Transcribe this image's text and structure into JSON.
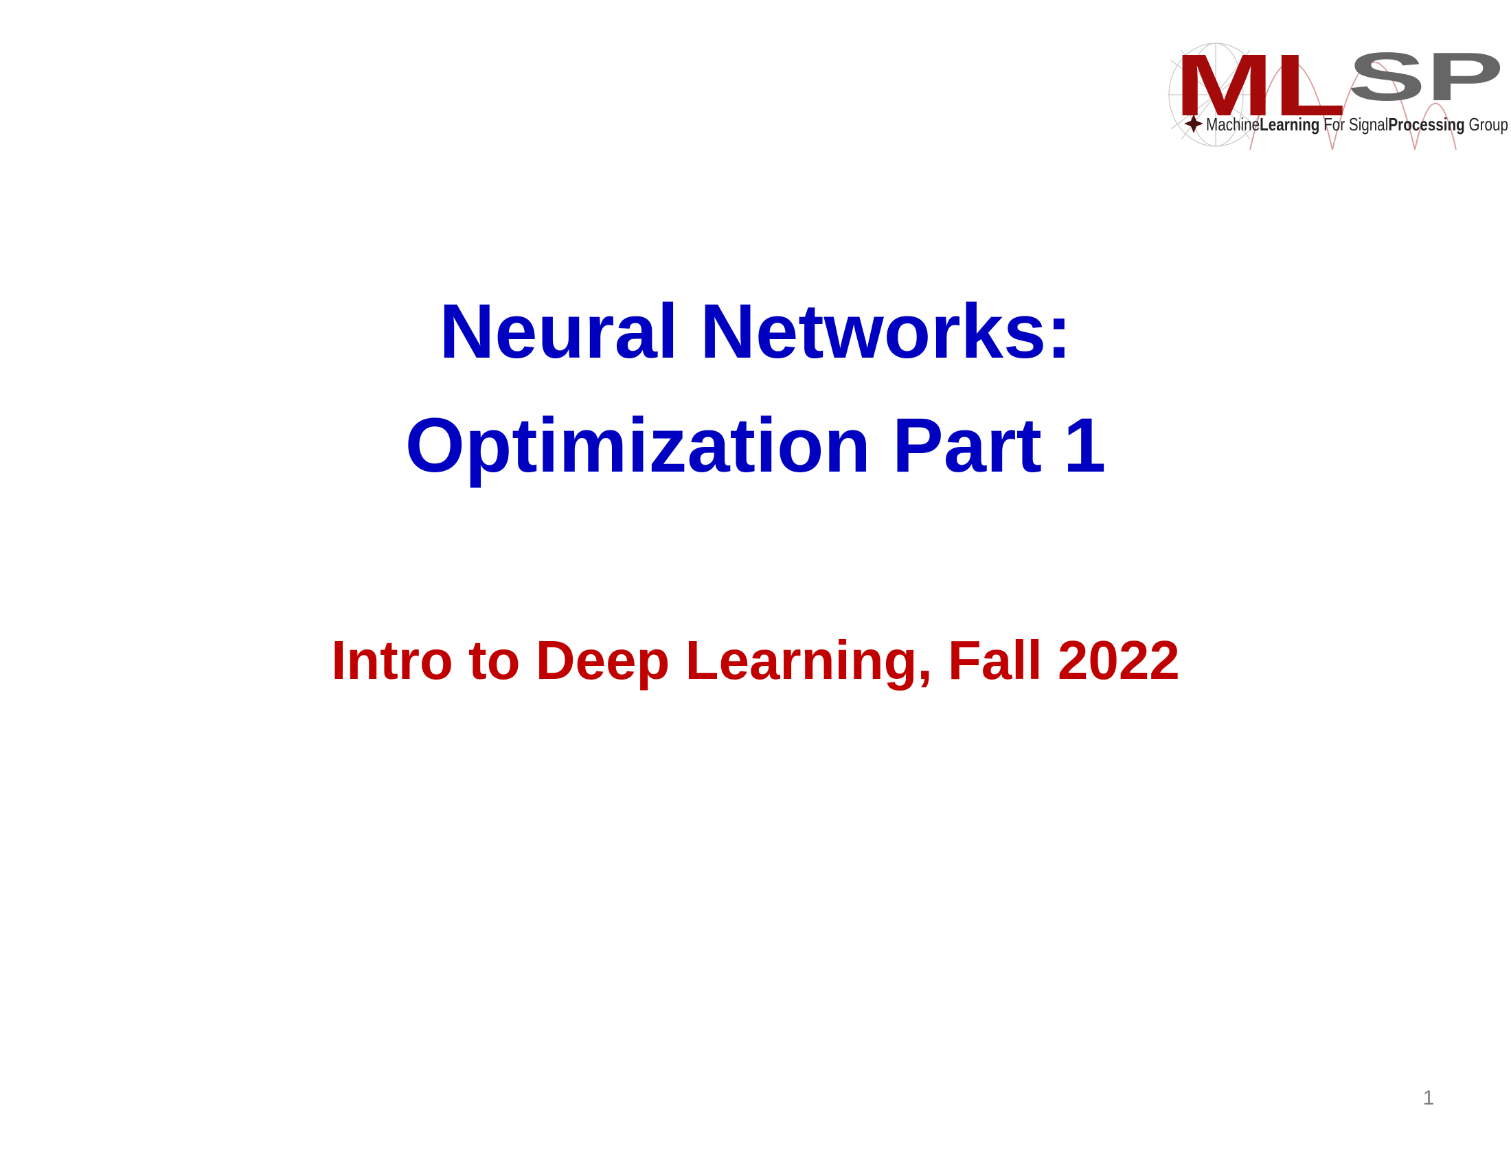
{
  "slide": {
    "title_lines": [
      "Neural Networks:",
      "Optimization Part 1"
    ],
    "subtitle": "Intro to Deep Learning, Fall 2022",
    "page_number": "1"
  },
  "logo": {
    "ml": "ML",
    "sp": "SP",
    "tagline_parts": [
      "Machine",
      "Learning",
      " For ",
      "Signal",
      "Processing",
      " Group"
    ],
    "colors": {
      "ml": "#a50a0a",
      "sp": "#666666",
      "tagline": "#222222",
      "decoration": "#c8c8c8"
    }
  },
  "colors": {
    "title": "#0000c0",
    "subtitle": "#c00000",
    "page_number": "#7f7f7f",
    "background": "#ffffff"
  }
}
